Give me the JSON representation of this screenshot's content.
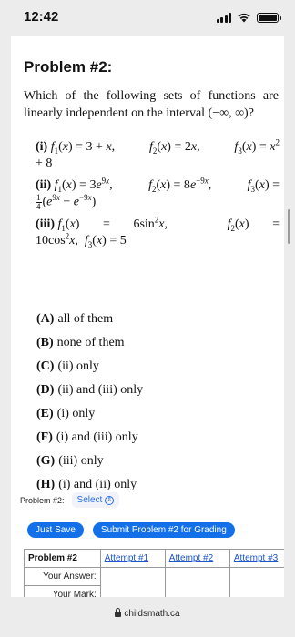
{
  "status": {
    "time": "12:42"
  },
  "problem": {
    "title": "Problem #2:",
    "question": "Which of the following sets of functions are linearly independent on the interval (−∞, ∞)?",
    "parts": {
      "i_label": "(i)",
      "ii_label": "(ii)",
      "iii_label": "(iii)"
    }
  },
  "options": [
    {
      "letter": "(A)",
      "text": "all of them"
    },
    {
      "letter": "(B)",
      "text": "none of them"
    },
    {
      "letter": "(C)",
      "text": "(ii) only"
    },
    {
      "letter": "(D)",
      "text": "(ii) and (iii) only"
    },
    {
      "letter": "(E)",
      "text": "(i) only"
    },
    {
      "letter": "(F)",
      "text": "(i) and (iii) only"
    },
    {
      "letter": "(G)",
      "text": "(iii) only"
    },
    {
      "letter": "(H)",
      "text": "(i) and (ii) only"
    }
  ],
  "answer_select": {
    "label": "Problem #2:",
    "value": "Select"
  },
  "buttons": {
    "save": "Just Save",
    "submit": "Submit Problem #2 for Grading"
  },
  "attempts": {
    "header": "Problem #2",
    "columns": [
      "Attempt #1",
      "Attempt #2",
      "Attempt #3"
    ],
    "rows": [
      "Your Answer:",
      "Your Mark:"
    ]
  },
  "browser": {
    "url": "childsmath.ca"
  },
  "colors": {
    "accent": "#1470e8",
    "link": "#1b55c9"
  }
}
